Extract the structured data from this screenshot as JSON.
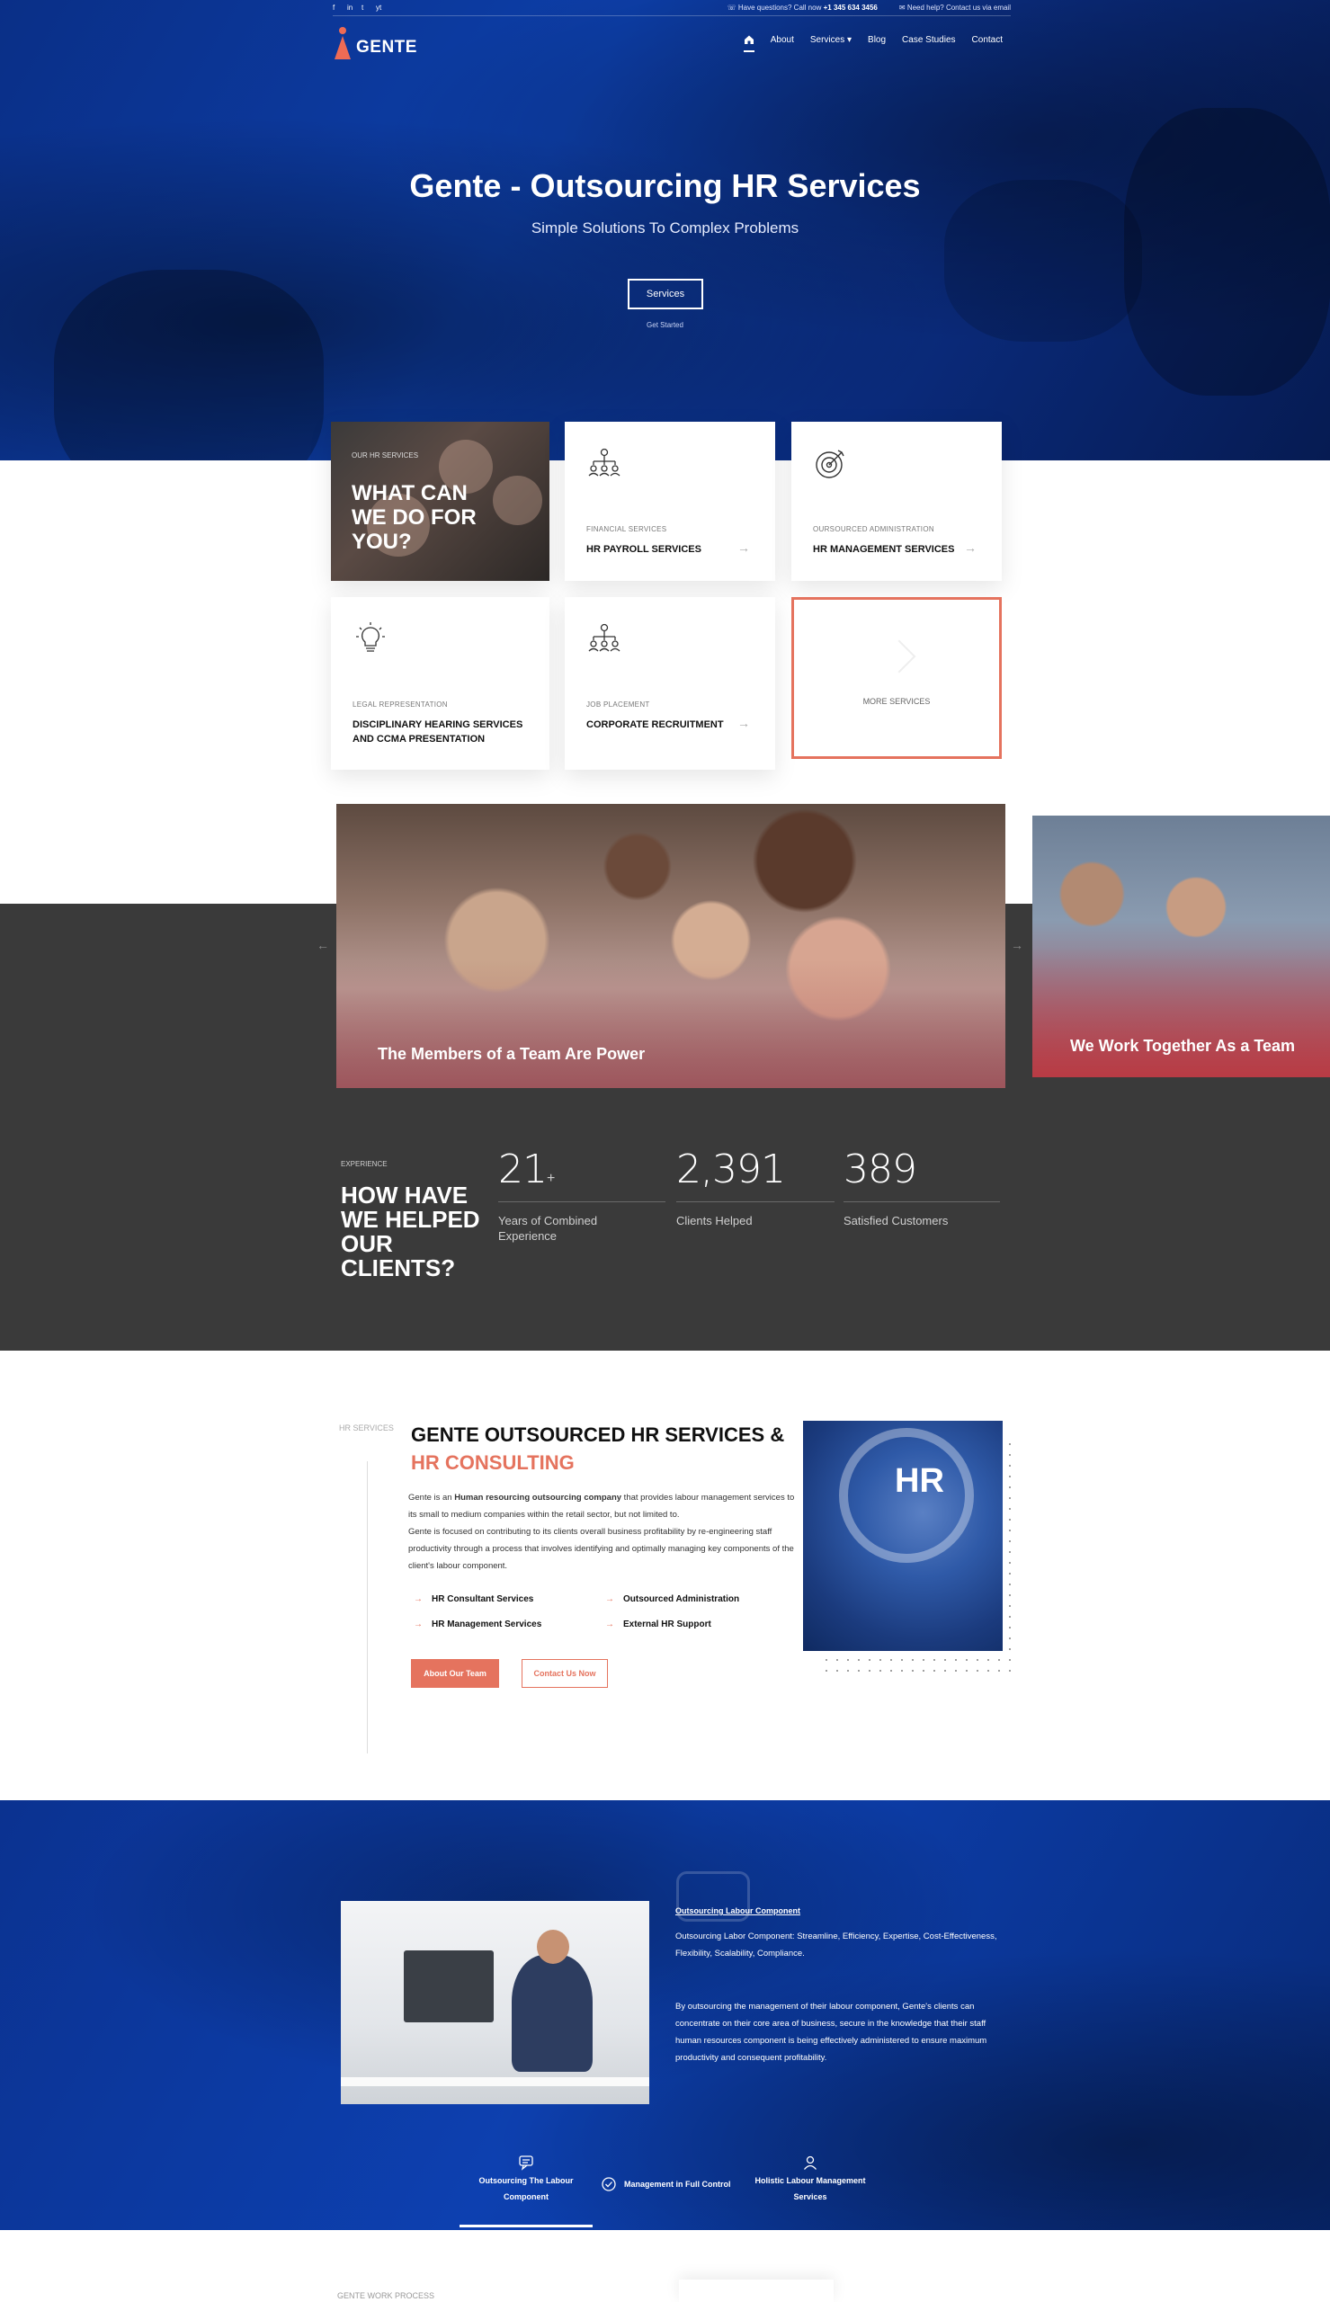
{
  "topbar": {
    "socials": [
      "f",
      "in",
      "t",
      "yt"
    ],
    "question_text": "Have questions? Call now",
    "phone": "+1 345 634 3456",
    "help_text": "Need help? Contact us via email"
  },
  "header": {
    "logo_text": "GENTE",
    "nav": [
      "About",
      "Services",
      "Blog",
      "Case Studies",
      "Contact"
    ],
    "services_chevron": "▾"
  },
  "hero": {
    "title": "Gente - Outsourcing HR Services",
    "subtitle": "Simple Solutions To Complex Problems",
    "button": "Services",
    "link": "Get Started"
  },
  "services": {
    "feature": {
      "label": "OUR HR SERVICES",
      "title": "WHAT CAN WE DO FOR YOU?"
    },
    "cards": [
      {
        "category": "FINANCIAL SERVICES",
        "title": "HR PAYROLL SERVICES",
        "icon": "org-chart-icon"
      },
      {
        "category": "OURSOURCED ADMINISTRATION",
        "title": "HR MANAGEMENT SERVICES",
        "icon": "target-icon"
      },
      {
        "category": "LEGAL REPRESENTATION",
        "title": "DISCIPLINARY HEARING SERVICES AND CCMA PRESENTATION",
        "icon": "lightbulb-icon"
      },
      {
        "category": "JOB PLACEMENT",
        "title": "CORPORATE RECRUITMENT",
        "icon": "org-chart-icon"
      }
    ],
    "more": "MORE SERVICES"
  },
  "slider": {
    "main_caption": "The Members of a Team Are Power",
    "side_caption": "We Work Together As a Team"
  },
  "experience": {
    "label": "EXPERIENCE",
    "title": "HOW HAVE WE HELPED OUR CLIENTS?",
    "stats": [
      {
        "value": "21",
        "suffix": "+",
        "label": "Years of Combined Experience"
      },
      {
        "value": "2,391",
        "suffix": "",
        "label": "Clients Helped"
      },
      {
        "value": "389",
        "suffix": "",
        "label": "Satisfied Customers"
      }
    ]
  },
  "about": {
    "side_label": "HR SERVICES",
    "title_main": "GENTE OUTSOURCED HR SERVICES & ",
    "title_accent": "HR CONSULTING",
    "p1_prefix": "Gente is an ",
    "p1_bold": "Human resourcing outsourcing company",
    "p1_suffix": " that provides labour management services to its small to medium companies within the retail sector, but not limited to.",
    "p2": "Gente is focused on contributing to its clients overall business profitability by re-engineering staff productivity through a process that involves identifying and optimally managing key components of the client's labour component.",
    "features": [
      "HR Consultant Services",
      "Outsourced Administration",
      "HR Management Services",
      "External HR Support"
    ],
    "btn_primary": "About Our Team",
    "btn_outline": "Contact Us Now",
    "image_text": "HR"
  },
  "labour": {
    "heading": "Outsourcing Labour Component",
    "p1": "Outsourcing Labor Component: Streamline, Efficiency, Expertise, Cost-Effectiveness, Flexibility, Scalability, Compliance.",
    "p2": "By outsourcing the management of their labour component, Gente's clients can concentrate on their core area of business, secure in the knowledge that their staff human resources component is being effectively administered to ensure maximum productivity and consequent profitability.",
    "tabs": [
      {
        "label": "Outsourcing The Labour Component",
        "icon": "chat-icon"
      },
      {
        "label": "Management in Full Control",
        "icon": "check-circle-icon"
      },
      {
        "label": "Holistic Labour Management Services",
        "icon": "user-icon"
      }
    ]
  },
  "process": {
    "label": "GENTE WORK PROCESS"
  },
  "colors": {
    "accent": "#e5735e",
    "hero_blue": "#0d3ea8",
    "dark": "#3a3a3a"
  }
}
